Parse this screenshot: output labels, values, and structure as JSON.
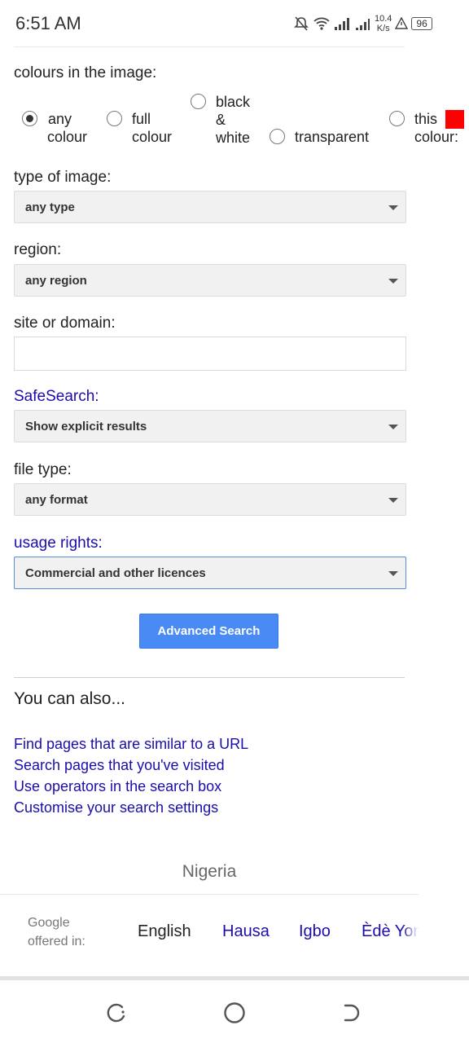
{
  "status_bar": {
    "time": "6:51 AM",
    "net_speed_value": "10.4",
    "net_speed_unit": "K/s",
    "battery": "96",
    "icons": [
      "mute-icon",
      "wifi-icon",
      "signal-icon",
      "signal-icon",
      "warning-icon",
      "battery-icon"
    ]
  },
  "colours": {
    "label": "colours in the image:",
    "options": [
      {
        "line1": "any",
        "line2": "colour",
        "selected": true
      },
      {
        "line1": "full",
        "line2": "colour",
        "selected": false
      },
      {
        "line1": "black",
        "line2": "&",
        "line3": "white",
        "selected": false
      },
      {
        "line1": "transparent",
        "selected": false
      },
      {
        "line1": "this",
        "line2": "colour:",
        "selected": false,
        "swatch": "#ff0000"
      }
    ]
  },
  "type_of_image": {
    "label": "type of image:",
    "value": "any type"
  },
  "region": {
    "label": "region:",
    "value": "any region"
  },
  "site": {
    "label": "site or domain:",
    "value": ""
  },
  "safesearch": {
    "label": "SafeSearch:",
    "value": "Show explicit results"
  },
  "file_type": {
    "label": "file type:",
    "value": "any format"
  },
  "usage_rights": {
    "label": "usage rights:",
    "value": "Commercial and other licences"
  },
  "advanced_button": "Advanced Search",
  "also": {
    "title": "You can also...",
    "links": [
      "Find pages that are similar to a URL",
      "Search pages that you've visited",
      "Use operators in the search box",
      "Customise your search settings"
    ]
  },
  "footer": {
    "country": "Nigeria",
    "offered_line1": "Google",
    "offered_line2": "offered in:",
    "languages": [
      "English",
      "Hausa",
      "Igbo",
      "Èdè Yor"
    ]
  },
  "colors": {
    "accent": "#4a8af4",
    "link": "#1a0dab"
  }
}
